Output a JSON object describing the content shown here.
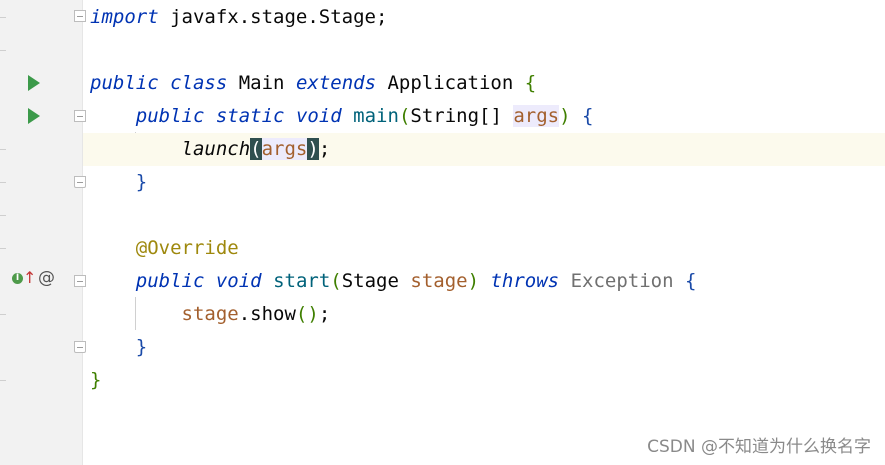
{
  "editor": {
    "lines": {
      "l1_kw": "import",
      "l1_rest": " javafx.stage.Stage;",
      "l3_kw1": "public",
      "l3_kw2": "class",
      "l3_name": " Main ",
      "l3_kw3": "extends",
      "l3_super": " Application ",
      "l3_brace": "{",
      "l4_kw1": "public",
      "l4_kw2": "static",
      "l4_kw3": "void",
      "l4_fn": "main",
      "l4_open": "(",
      "l4_type": "String[] ",
      "l4_param": "args",
      "l4_close": ")",
      "l4_brace": "{",
      "l5_call": "launch",
      "l5_open": "(",
      "l5_arg": "args",
      "l5_close": ")",
      "l5_semi": ";",
      "l6_brace": "}",
      "l8_annotation": "@Override",
      "l9_kw1": "public",
      "l9_kw2": "void",
      "l9_fn": "start",
      "l9_open": "(",
      "l9_type": "Stage ",
      "l9_param": "stage",
      "l9_close": ")",
      "l9_kw3": "throws",
      "l9_exc": " Exception ",
      "l9_brace": "{",
      "l10_var": "stage",
      "l10_call": ".show",
      "l10_parens": "()",
      "l10_semi": ";",
      "l11_brace": "}",
      "l12_brace": "}"
    }
  },
  "gutter": {
    "impl_badge": "I",
    "override_arrow": "↑",
    "at_symbol": "@"
  },
  "watermark": "CSDN @不知道为什么换名字"
}
